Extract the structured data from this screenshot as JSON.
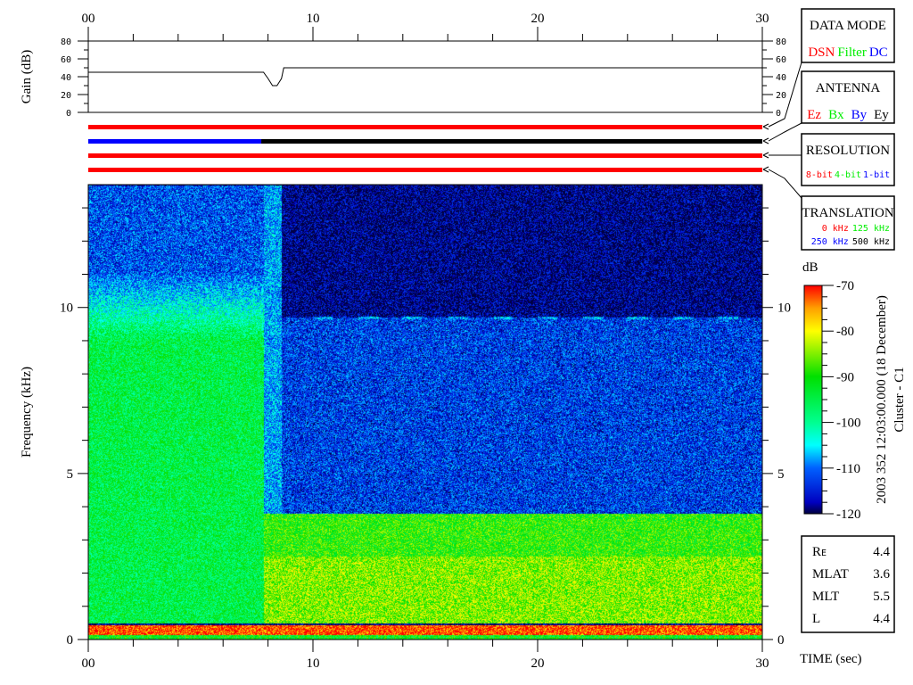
{
  "chart_data": {
    "type": "heatmap",
    "title": "",
    "time_axis": {
      "label": "TIME (sec)",
      "range": [
        0,
        30
      ],
      "tick_labels": [
        "00",
        "10",
        "20",
        "30"
      ],
      "minor_step": 2
    },
    "frequency_axis": {
      "label": "Frequency (kHz)",
      "range": [
        0,
        13.7
      ],
      "tick_labels": [
        "0",
        "5",
        "10"
      ],
      "minor_step": 1
    },
    "gain_panel": {
      "label": "Gain (dB)",
      "range": [
        0,
        80
      ],
      "tick_labels": [
        "0",
        "20",
        "40",
        "60",
        "80"
      ],
      "t": [
        0,
        7.8,
        8.0,
        8.2,
        8.4,
        8.6,
        8.7,
        30
      ],
      "gain": [
        45,
        45,
        38,
        30,
        30,
        38,
        50,
        50
      ]
    },
    "colorbar": {
      "label": "dB",
      "range": [
        -120,
        -70
      ],
      "tick_labels": [
        "-70",
        "-80",
        "-90",
        "-100",
        "-110",
        "-120"
      ]
    },
    "status_strips": [
      {
        "name": "data-mode",
        "segments": [
          {
            "from": 0,
            "to": 30,
            "color": "#ff0000"
          }
        ]
      },
      {
        "name": "antenna",
        "segments": [
          {
            "from": 0,
            "to": 7.7,
            "color": "#0000ff"
          },
          {
            "from": 7.7,
            "to": 30,
            "color": "#000000"
          }
        ]
      },
      {
        "name": "resolution",
        "segments": [
          {
            "from": 0,
            "to": 30,
            "color": "#ff0000"
          }
        ]
      },
      {
        "name": "translation",
        "segments": [
          {
            "from": 0,
            "to": 30,
            "color": "#ff0000"
          }
        ]
      }
    ],
    "spectrogram_regions_db": [
      {
        "t": [
          0,
          7.8
        ],
        "f": [
          11,
          13.7
        ],
        "level": -112
      },
      {
        "t": [
          0,
          7.8
        ],
        "f": [
          0.5,
          11
        ],
        "level": -95
      },
      {
        "t": [
          7.8,
          8.6
        ],
        "f": [
          3.8,
          13.7
        ],
        "level": -108
      },
      {
        "t": [
          8.6,
          30
        ],
        "f": [
          9.7,
          13.7
        ],
        "level": -119
      },
      {
        "t": [
          8.6,
          30
        ],
        "f": [
          3.8,
          9.7
        ],
        "level": -113
      },
      {
        "t": [
          7.8,
          30
        ],
        "f": [
          0.5,
          3.8
        ],
        "level": -89
      },
      {
        "t": [
          0,
          30
        ],
        "f": [
          0.15,
          0.45
        ],
        "level": -72
      }
    ],
    "dashed_line": {
      "f": 9.7,
      "t": [
        9,
        30
      ],
      "level": -108
    }
  },
  "legend": {
    "data_mode": {
      "title": "DATA MODE",
      "items": [
        {
          "label": "DSN",
          "color": "#ff0000"
        },
        {
          "label": "Filter",
          "color": "#00ee00"
        },
        {
          "label": "DC",
          "color": "#0000ff"
        }
      ]
    },
    "antenna": {
      "title": "ANTENNA",
      "items": [
        {
          "label": "Ez",
          "color": "#ff0000"
        },
        {
          "label": "Bx",
          "color": "#00ee00"
        },
        {
          "label": "By",
          "color": "#0000ff"
        },
        {
          "label": "Ey",
          "color": "#000000"
        }
      ]
    },
    "resolution": {
      "title": "RESOLUTION",
      "items": [
        {
          "label": "8-bit",
          "color": "#ff0000"
        },
        {
          "label": "4-bit",
          "color": "#00ee00"
        },
        {
          "label": "1-bit",
          "color": "#0000ff"
        }
      ]
    },
    "translation": {
      "title": "TRANSLATION",
      "items": [
        {
          "label": "0 kHz",
          "color": "#ff0000"
        },
        {
          "label": "125 kHz",
          "color": "#00ee00"
        },
        {
          "label": "250 kHz",
          "color": "#0000ff"
        },
        {
          "label": "500 kHz",
          "color": "#000000"
        }
      ]
    }
  },
  "timestamp": "2003 352 12:03:00.000 (18 December)",
  "spacecraft": "Cluster - C1",
  "position": [
    {
      "label": "R",
      "sub": "E",
      "value": "4.4"
    },
    {
      "label": "MLAT",
      "sub": "",
      "value": "3.6"
    },
    {
      "label": "MLT",
      "sub": "",
      "value": "5.5"
    },
    {
      "label": "L",
      "sub": "",
      "value": "4.4"
    }
  ]
}
